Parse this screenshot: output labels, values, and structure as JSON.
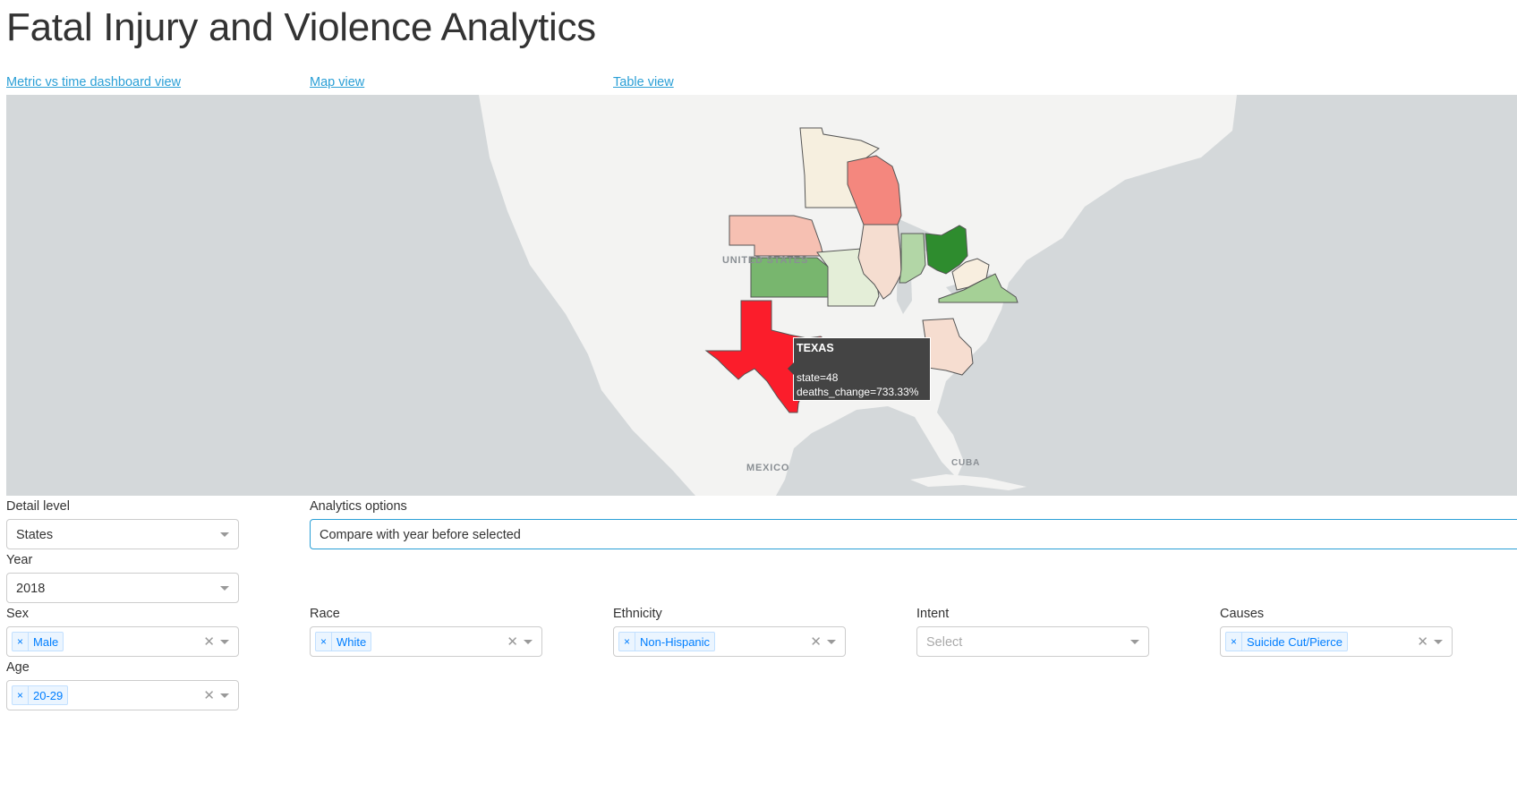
{
  "page": {
    "title": "Fatal Injury and Violence Analytics"
  },
  "nav": {
    "links": [
      {
        "label": "Metric vs time dashboard view"
      },
      {
        "label": "Map view"
      },
      {
        "label": "Table view"
      }
    ]
  },
  "map": {
    "labels": {
      "us": "UNITED STATES",
      "mexico": "MEXICO",
      "cuba": "CUBA"
    },
    "tooltip": {
      "title": "TEXAS",
      "line1": "state=48",
      "line2": "deaths_change=733.33%"
    },
    "colors": {
      "water": "#d4d8da",
      "land": "#f3f3f2",
      "texas": "#fb1d2b",
      "wisconsin": "#f4877e",
      "nebraska": "#f6c0b2",
      "minnesota": "#f6efdf",
      "illinois": "#f5ddd0",
      "georgia": "#f6ddd0",
      "missouri": "#e4eed8",
      "indiana": "#b2d6a6",
      "ohio": "#2e8c2e",
      "kansas": "#78b66e",
      "virginia": "#a5d096",
      "west_virginia": "#f8eedf"
    }
  },
  "filters": {
    "detail_level": {
      "label": "Detail level",
      "value": "States"
    },
    "analytics": {
      "label": "Analytics options",
      "value": "Compare with year before selected"
    },
    "year": {
      "label": "Year",
      "value": "2018"
    },
    "sex": {
      "label": "Sex",
      "tag": "Male"
    },
    "race": {
      "label": "Race",
      "tag": "White"
    },
    "ethnicity": {
      "label": "Ethnicity",
      "tag": "Non-Hispanic"
    },
    "intent": {
      "label": "Intent",
      "placeholder": "Select"
    },
    "causes": {
      "label": "Causes",
      "tag": "Suicide Cut/Pierce"
    },
    "age": {
      "label": "Age",
      "tag": "20-29"
    }
  },
  "glyphs": {
    "remove": "×",
    "clear": "✕"
  }
}
